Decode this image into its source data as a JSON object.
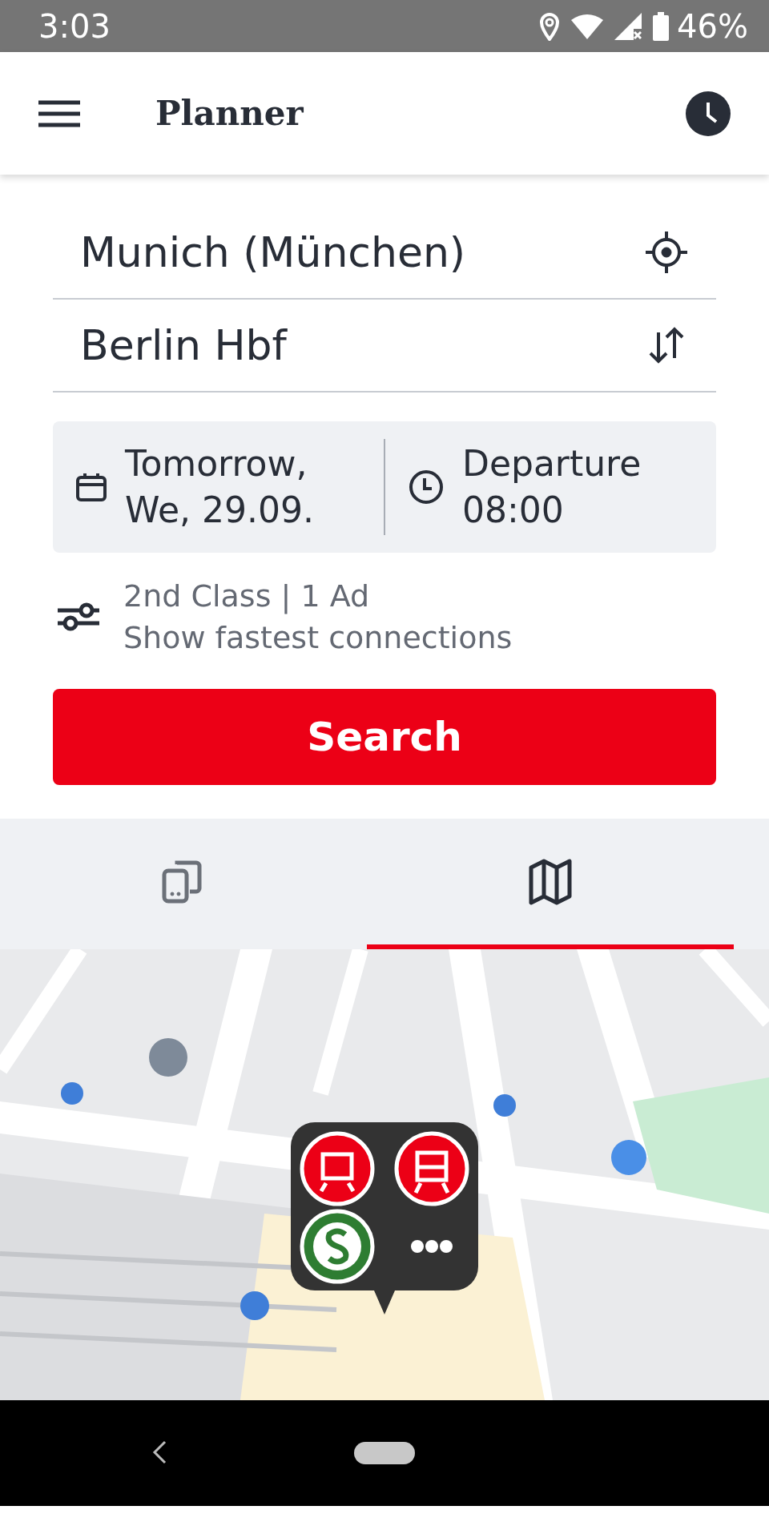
{
  "status_bar": {
    "time": "3:03",
    "battery": "46%"
  },
  "header": {
    "title": "Planner"
  },
  "from": {
    "value": "Munich (München)"
  },
  "to": {
    "value": "Berlin Hbf"
  },
  "date": {
    "line1": "Tomorrow,",
    "line2": "We, 29.09."
  },
  "time": {
    "line1": "Departure",
    "line2": "08:00"
  },
  "options": {
    "line1": "2nd Class | 1 Ad",
    "line2": "Show fastest connections"
  },
  "search_button": "Search",
  "tabs": [
    {
      "kind": "devices",
      "selected": false
    },
    {
      "kind": "map",
      "selected": true
    }
  ]
}
